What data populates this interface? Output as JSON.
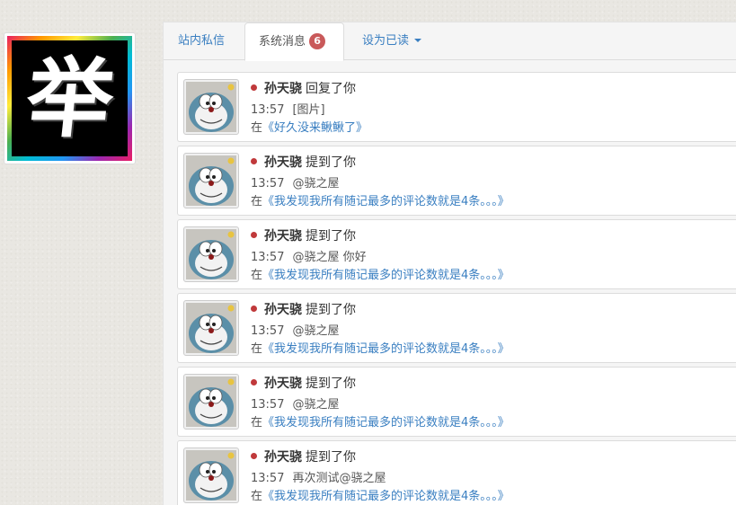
{
  "tabs": {
    "inbox": "站内私信",
    "system": "系统消息",
    "system_badge": "6",
    "mark_read": "设为已读"
  },
  "notifications": [
    {
      "user": "孙天骁",
      "action": "回复了你",
      "time": "13:57",
      "content": "[图片]",
      "prefix": "在",
      "post": "《好久没来鳅鳅了》"
    },
    {
      "user": "孙天骁",
      "action": "提到了你",
      "time": "13:57",
      "content": "@骁之屋",
      "prefix": "在",
      "post": "《我发现我所有随记最多的评论数就是4条。。。》"
    },
    {
      "user": "孙天骁",
      "action": "提到了你",
      "time": "13:57",
      "content": "@骁之屋 你好",
      "prefix": "在",
      "post": "《我发现我所有随记最多的评论数就是4条。。。》"
    },
    {
      "user": "孙天骁",
      "action": "提到了你",
      "time": "13:57",
      "content": "@骁之屋",
      "prefix": "在",
      "post": "《我发现我所有随记最多的评论数就是4条。。。》"
    },
    {
      "user": "孙天骁",
      "action": "提到了你",
      "time": "13:57",
      "content": "@骁之屋",
      "prefix": "在",
      "post": "《我发现我所有随记最多的评论数就是4条。。。》"
    },
    {
      "user": "孙天骁",
      "action": "提到了你",
      "time": "13:57",
      "content": "再次测试@骁之屋",
      "prefix": "在",
      "post": "《我发现我所有随记最多的评论数就是4条。。。》"
    }
  ],
  "profile": {
    "avatar_glyph": "举"
  },
  "icons": {
    "unread": "unread-dot-icon",
    "menu": "caret-down-icon"
  },
  "colors": {
    "link": "#3a7fc1",
    "badge": "#c9595a",
    "unread_dot": "#c0393b"
  }
}
